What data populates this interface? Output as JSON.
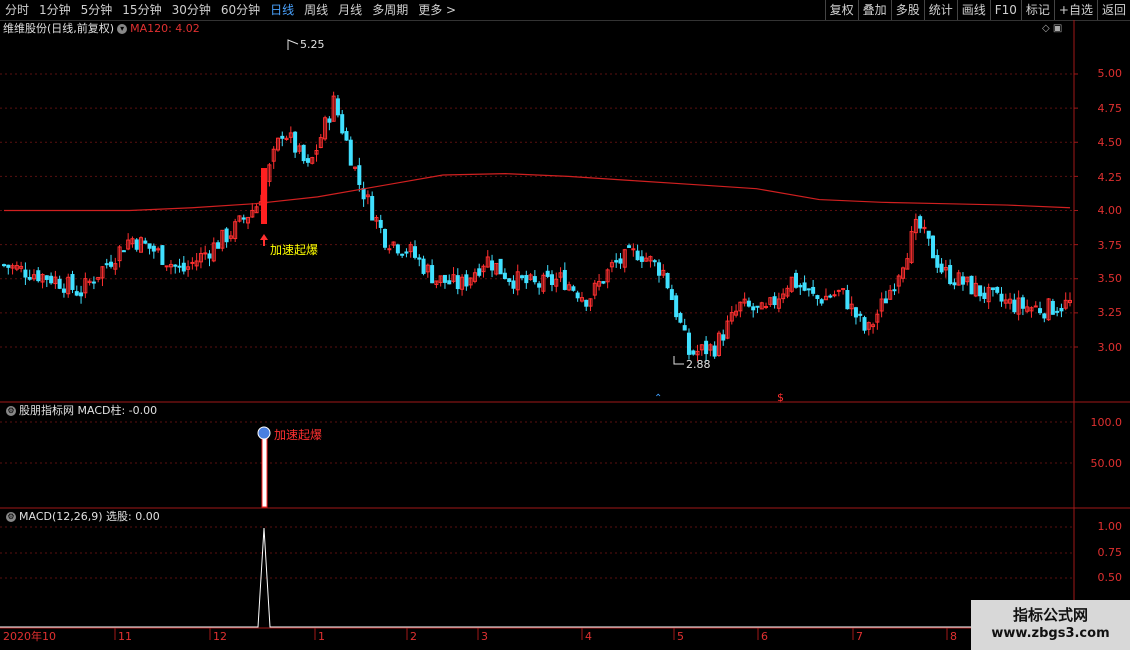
{
  "toolbar": {
    "periods": [
      "分时",
      "1分钟",
      "5分钟",
      "15分钟",
      "30分钟",
      "60分钟",
      "日线",
      "周线",
      "月线",
      "多周期",
      "更多 >"
    ],
    "active_period": "日线",
    "actions": [
      "复权",
      "叠加",
      "多股",
      "统计",
      "画线",
      "F10",
      "标记",
      "+自选",
      "返回"
    ]
  },
  "main_panel": {
    "title": "维维股份(日线,前复权)",
    "ma_label": "MA120: 4.02",
    "high_marker": "5.25",
    "low_marker": "2.88",
    "signal_text": "加速起爆",
    "y_ticks": [
      "5.00",
      "4.75",
      "4.50",
      "4.25",
      "4.00",
      "3.75",
      "3.50",
      "3.25",
      "3.00"
    ]
  },
  "indicator_panel": {
    "title": "股朋指标网  MACD柱: -0.00",
    "signal_text": "加速起爆",
    "y_ticks": [
      "100.0",
      "50.00"
    ]
  },
  "macd_panel": {
    "title": "MACD(12,26,9)  选股: 0.00",
    "y_ticks": [
      "1.00",
      "0.75",
      "0.50"
    ]
  },
  "date_axis": [
    "2020年10",
    "11",
    "12",
    "1",
    "2",
    "3",
    "4",
    "5",
    "6",
    "7",
    "8"
  ],
  "watermark": {
    "title": "指标公式网",
    "url": "www.zbgs3.com"
  },
  "colors": {
    "up": "#ff3030",
    "down": "#40e0ff",
    "ma": "#d02020",
    "signal_text": "#ffff00",
    "axis": "#e03030"
  },
  "chart_data": {
    "type": "candlestick",
    "title": "维维股份(日线,前复权)",
    "ylim": [
      2.75,
      5.2
    ],
    "x_range": [
      "2020-10",
      "2021-08"
    ],
    "annotations": [
      {
        "label": "5.25",
        "kind": "high"
      },
      {
        "label": "2.88",
        "kind": "low"
      },
      {
        "label": "加速起爆",
        "kind": "signal"
      }
    ],
    "series": [
      {
        "name": "MA120",
        "last_value": 4.02,
        "values": [
          4.0,
          4.0,
          4.0,
          4.02,
          4.05,
          4.1,
          4.18,
          4.26,
          4.27,
          4.25,
          4.22,
          4.19,
          4.16,
          4.08,
          4.06,
          4.05,
          4.04,
          4.02
        ]
      },
      {
        "name": "close",
        "values": [
          3.6,
          3.55,
          3.5,
          3.4,
          3.6,
          3.8,
          3.7,
          3.55,
          3.7,
          3.85,
          4.05,
          4.6,
          4.3,
          4.8,
          4.2,
          3.8,
          3.7,
          3.5,
          3.45,
          3.65,
          3.5,
          3.45,
          3.5,
          3.35,
          3.6,
          3.7,
          3.55,
          2.95,
          3.0,
          3.3,
          3.25,
          3.5,
          3.35,
          3.4,
          3.1,
          3.45,
          3.9,
          3.55,
          3.45,
          3.35,
          3.3,
          3.28,
          3.32
        ]
      }
    ]
  }
}
